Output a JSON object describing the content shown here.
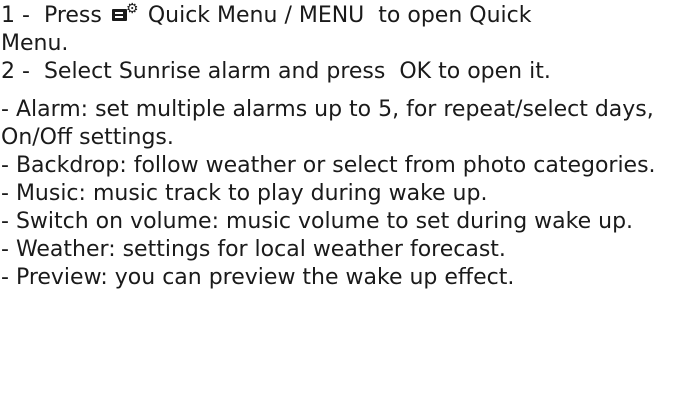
{
  "step1": {
    "number": "1 -",
    "pre": "Press",
    "icon": "quick-menu-icon",
    "quick_menu_key": "Quick Menu / MENU",
    "mid": "to open",
    "target_line1": "Quick",
    "target_line2": "Menu",
    "end": "."
  },
  "step2": {
    "number": "2 -",
    "pre": "Select",
    "item": "Sunrise alarm",
    "mid": "and press",
    "key": "OK",
    "end": "to open it."
  },
  "items": [
    {
      "prefix": "- ",
      "term": "Alarm",
      "desc": ": set multiple alarms up to 5, for repeat/select days, On/Off settings."
    },
    {
      "prefix": "- ",
      "term": "Backdrop",
      "desc": ": follow weather or select from photo categories."
    },
    {
      "prefix": "- ",
      "term": "Music",
      "desc": ": music track to play during wake up."
    },
    {
      "prefix": "- ",
      "term": "Switch on volume",
      "desc": ": music volume to set during wake up."
    },
    {
      "prefix": "- ",
      "term": "Weather",
      "desc": ": settings for local weather forecast."
    },
    {
      "prefix": "- ",
      "term": "Preview",
      "desc": ": you can preview the wake up effect."
    }
  ]
}
